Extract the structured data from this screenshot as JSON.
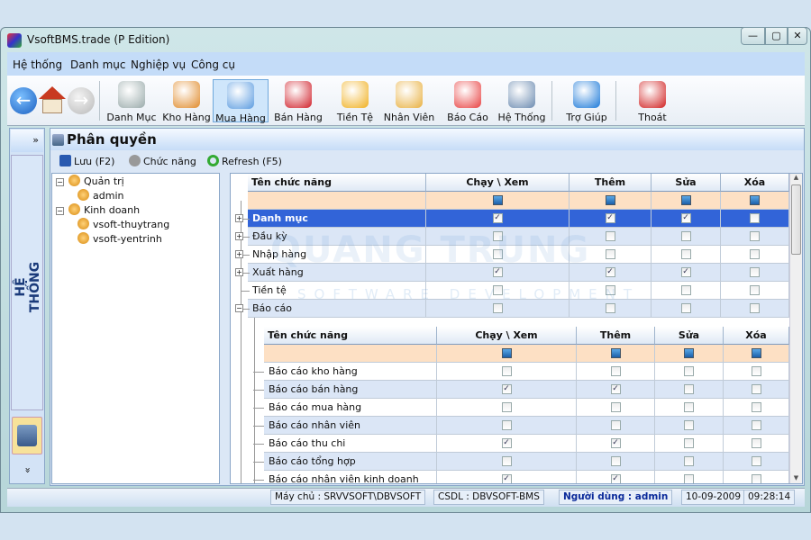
{
  "window": {
    "title": "VsoftBMS.trade (P Edition)",
    "controls": [
      "—",
      "▢",
      "✕"
    ]
  },
  "menu": [
    {
      "label": "Hệ thống"
    },
    {
      "label": "Danh mục"
    },
    {
      "label": "Nghiệp vụ"
    },
    {
      "label": "Công cụ"
    }
  ],
  "toolbar": {
    "items": [
      {
        "label": "Danh Mục",
        "icon": "list-icon",
        "color": "#9aa"
      },
      {
        "label": "Kho Hàng",
        "icon": "box-icon",
        "color": "#e08a2a"
      },
      {
        "label": "Mua Hàng",
        "icon": "purchase-icon",
        "color": "#5a9be0",
        "active": true
      },
      {
        "label": "Bán Hàng",
        "icon": "sales-icon",
        "color": "#d0202a"
      },
      {
        "label": "Tiền Tệ",
        "icon": "currency-icon",
        "color": "#f0b020"
      },
      {
        "label": "Nhân Viên",
        "icon": "employee-icon",
        "color": "#e8b040"
      },
      {
        "label": "Báo Cáo",
        "icon": "report-chart-icon",
        "color": "#e84040"
      },
      {
        "label": "Hệ Thống",
        "icon": "server-icon",
        "color": "#6a8ab0"
      },
      {
        "label": "Trợ Giúp",
        "icon": "help-icon",
        "color": "#1a78d8"
      },
      {
        "label": "Thoát",
        "icon": "exit-icon",
        "color": "#d02020"
      }
    ]
  },
  "sidebar": {
    "expand": "»",
    "label": "HỆ THỐNG",
    "more": "»"
  },
  "panel": {
    "title": "Phân quyền",
    "actions": [
      {
        "label": "Lưu (F2)"
      },
      {
        "label": "Chức năng"
      },
      {
        "label": "Refresh (F5)"
      }
    ]
  },
  "tree": [
    {
      "label": "Quản trị",
      "level": 0,
      "group": true
    },
    {
      "label": "admin",
      "level": 1
    },
    {
      "label": "Kinh doanh",
      "level": 0,
      "group": true
    },
    {
      "label": "vsoft-thuytrang",
      "level": 1
    },
    {
      "label": "vsoft-yentrinh",
      "level": 1
    }
  ],
  "grid": {
    "columns": [
      "Tên chức năng",
      "Chạy \\ Xem",
      "Thêm",
      "Sửa",
      "Xóa"
    ],
    "rows": [
      {
        "name": "Danh mục",
        "perm": [
          true,
          true,
          true,
          false
        ],
        "selected": true,
        "expander": "+"
      },
      {
        "name": "Đầu kỳ",
        "perm": [
          false,
          false,
          false,
          false
        ],
        "expander": "+"
      },
      {
        "name": "Nhập hàng",
        "perm": [
          false,
          false,
          false,
          false
        ],
        "expander": "+"
      },
      {
        "name": "Xuất hàng",
        "perm": [
          true,
          true,
          true,
          false
        ],
        "expander": "+"
      },
      {
        "name": "Tiền tệ",
        "perm": [
          false,
          false,
          false,
          false
        ],
        "expander": ""
      },
      {
        "name": "Báo cáo",
        "perm": [
          false,
          false,
          false,
          false
        ],
        "expander": "−"
      }
    ]
  },
  "subgrid": {
    "columns": [
      "Tên chức năng",
      "Chạy \\ Xem",
      "Thêm",
      "Sửa",
      "Xóa"
    ],
    "rows": [
      {
        "name": "Báo cáo kho hàng",
        "perm": [
          false,
          false,
          false,
          false
        ]
      },
      {
        "name": "Báo cáo bán hàng",
        "perm": [
          true,
          true,
          false,
          false
        ]
      },
      {
        "name": "Báo cáo mua hàng",
        "perm": [
          false,
          false,
          false,
          false
        ]
      },
      {
        "name": "Báo cáo nhân viên",
        "perm": [
          false,
          false,
          false,
          false
        ]
      },
      {
        "name": "Báo cáo thu chi",
        "perm": [
          true,
          true,
          false,
          false
        ]
      },
      {
        "name": "Báo cáo tổng hợp",
        "perm": [
          false,
          false,
          false,
          false
        ]
      },
      {
        "name": "Báo cáo nhân viên kinh doanh",
        "perm": [
          true,
          true,
          false,
          false
        ]
      }
    ]
  },
  "watermark": {
    "line1": "QUANG TRUNG",
    "line2": "SOFTWARE DEVELOPMENT"
  },
  "status": {
    "server": "Máy chủ : SRVVSOFT\\DBVSOFT",
    "db": "CSDL : DBVSOFT-BMS",
    "user": "Người dùng : admin",
    "date": "10-09-2009",
    "time": "09:28:14"
  }
}
